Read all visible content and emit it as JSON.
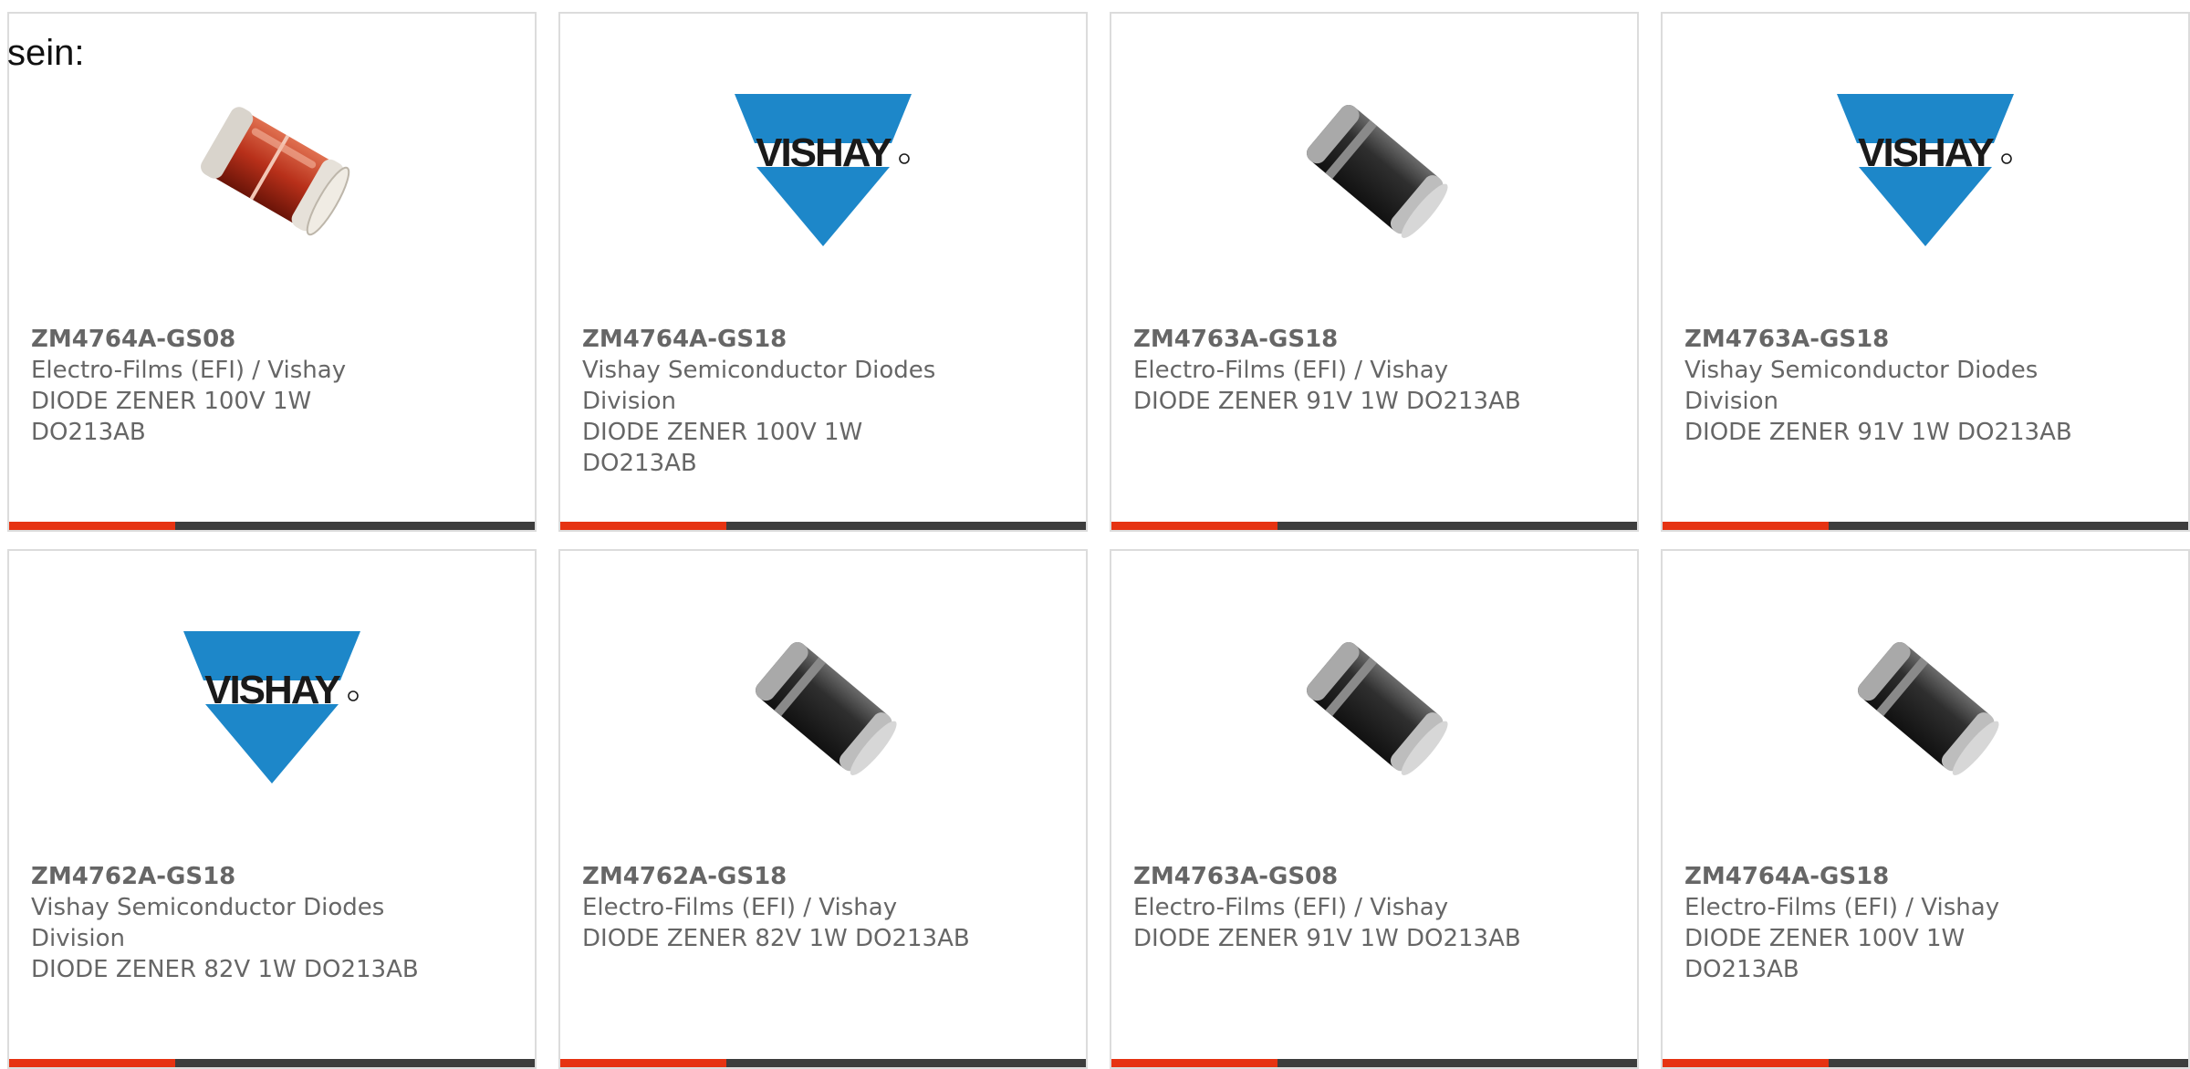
{
  "intro_text": "sein:",
  "colors": {
    "accent": "#e63312",
    "bar_dark": "#3d3d3d",
    "vishay_blue": "#1d87c9",
    "text_gray": "#666666"
  },
  "products": [
    {
      "part_number": "ZM4764A-GS08",
      "manufacturer": "Electro-Films (EFI) / Vishay",
      "description": "DIODE ZENER 100V 1W DO213AB",
      "image": "glass-melf-diode"
    },
    {
      "part_number": "ZM4764A-GS18",
      "manufacturer": "Vishay Semiconductor Diodes Division",
      "description": "DIODE ZENER 100V 1W DO213AB",
      "image": "vishay-logo"
    },
    {
      "part_number": "ZM4763A-GS18",
      "manufacturer": "Electro-Films (EFI) / Vishay",
      "description": "DIODE ZENER 91V 1W DO213AB",
      "image": "black-melf-diode"
    },
    {
      "part_number": "ZM4763A-GS18",
      "manufacturer": "Vishay Semiconductor Diodes Division",
      "description": "DIODE ZENER 91V 1W DO213AB",
      "image": "vishay-logo"
    },
    {
      "part_number": "ZM4762A-GS18",
      "manufacturer": "Vishay Semiconductor Diodes Division",
      "description": "DIODE ZENER 82V 1W DO213AB",
      "image": "vishay-logo"
    },
    {
      "part_number": "ZM4762A-GS18",
      "manufacturer": "Electro-Films (EFI) / Vishay",
      "description": "DIODE ZENER 82V 1W DO213AB",
      "image": "black-melf-diode"
    },
    {
      "part_number": "ZM4763A-GS08",
      "manufacturer": "Electro-Films (EFI) / Vishay",
      "description": "DIODE ZENER 91V 1W DO213AB",
      "image": "black-melf-diode"
    },
    {
      "part_number": "ZM4764A-GS18",
      "manufacturer": "Electro-Films (EFI) / Vishay",
      "description": "DIODE ZENER 100V 1W DO213AB",
      "image": "black-melf-diode"
    }
  ]
}
